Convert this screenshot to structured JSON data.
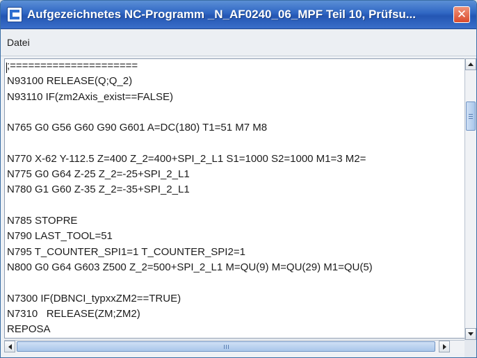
{
  "window": {
    "title": "Aufgezeichnetes NC-Programm _N_AF0240_06_MPF Teil 10, Prüfsu...",
    "close_glyph": "✕"
  },
  "menu": {
    "items": [
      "Datei"
    ]
  },
  "editor": {
    "lines": [
      ";=====================",
      "N93100 RELEASE(Q;Q_2)",
      "N93110 IF(zm2Axis_exist==FALSE)",
      "",
      "N765 G0 G56 G60 G90 G601 A=DC(180) T1=51 M7 M8",
      "",
      "N770 X-62 Y-112.5 Z=400 Z_2=400+SPI_2_L1 S1=1000 S2=1000 M1=3 M2=",
      "N775 G0 G64 Z-25 Z_2=-25+SPI_2_L1",
      "N780 G1 G60 Z-35 Z_2=-35+SPI_2_L1",
      "",
      "N785 STOPRE",
      "N790 LAST_TOOL=51",
      "N795 T_COUNTER_SPI1=1 T_COUNTER_SPI2=1",
      "N800 G0 G64 G603 Z500 Z_2=500+SPI_2_L1 M=QU(9) M=QU(29) M1=QU(5)",
      "",
      "N7300 IF(DBNCI_typxxZM2==TRUE)",
      "N7310   RELEASE(ZM;ZM2)",
      "REPOSA"
    ]
  },
  "icons": {
    "app": "application-window-icon",
    "close": "close-icon",
    "scroll_up": "arrow-up-icon",
    "scroll_down": "arrow-down-icon",
    "scroll_left": "arrow-left-icon",
    "scroll_right": "arrow-right-icon"
  },
  "colors": {
    "titlebar": "#2f66c3",
    "close_button": "#d94a2c",
    "scroll_thumb": "#a9c6ea"
  }
}
